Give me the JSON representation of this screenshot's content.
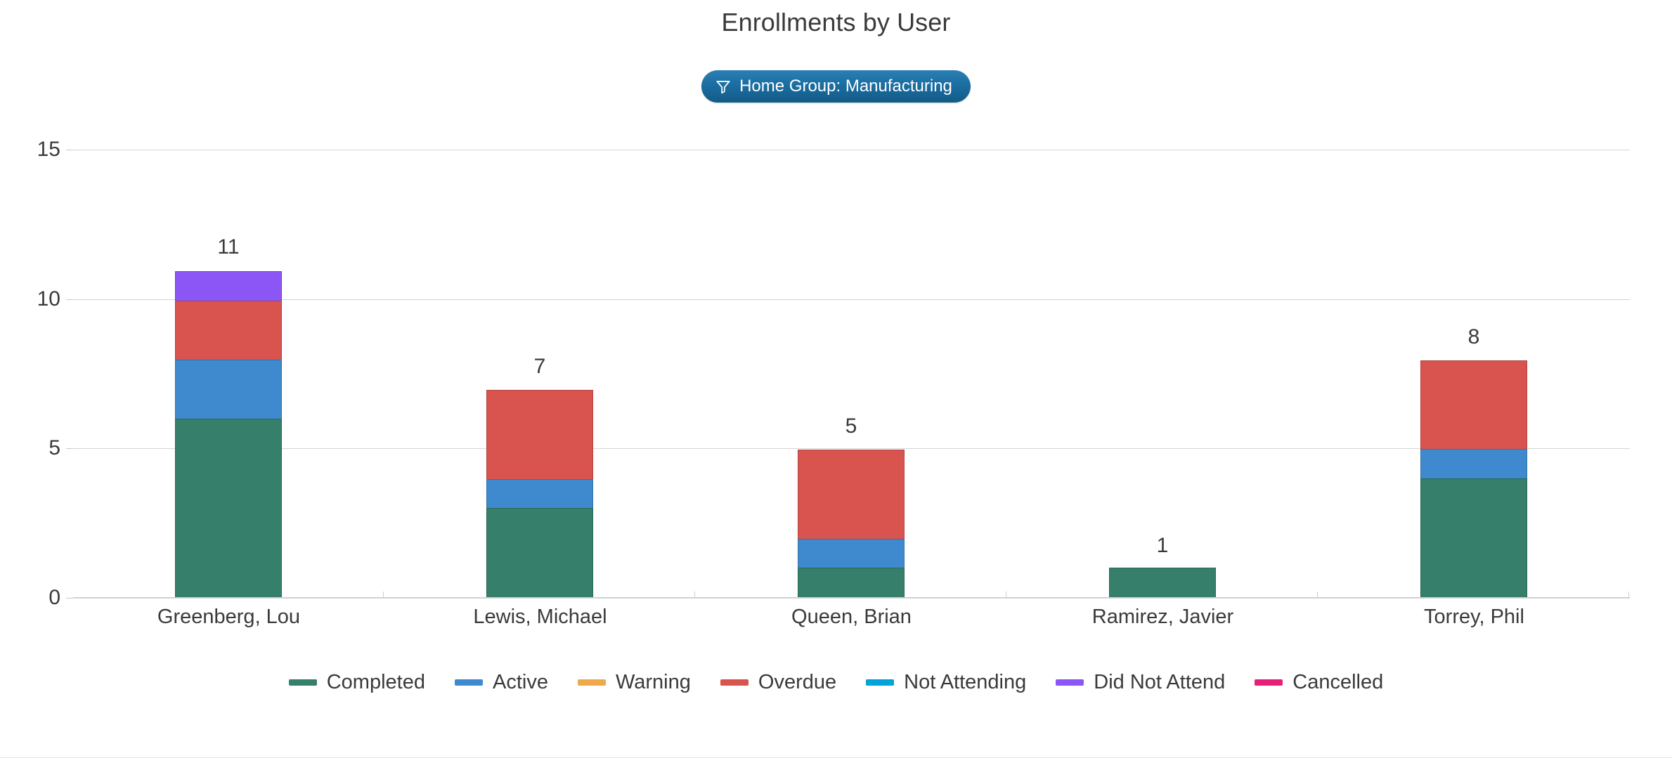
{
  "header": {
    "title": "Enrollments by User"
  },
  "filter": {
    "icon": "filter-funnel-icon",
    "label": "Home Group: Manufacturing",
    "chip_color": "#1b6e9f"
  },
  "chart_data": {
    "type": "bar",
    "stacked": true,
    "title": "Enrollments by User",
    "xlabel": "",
    "ylabel": "",
    "ylim": [
      0,
      15
    ],
    "yticks": [
      0,
      5,
      10,
      15
    ],
    "ytick_labels": [
      "0",
      "5",
      "10",
      "15"
    ],
    "grid": true,
    "legend_position": "bottom",
    "categories": [
      "Greenberg, Lou",
      "Lewis, Michael",
      "Queen, Brian",
      "Ramirez, Javier",
      "Torrey, Phil"
    ],
    "totals": [
      11,
      7,
      5,
      1,
      8
    ],
    "total_labels": [
      "11",
      "7",
      "5",
      "1",
      "8"
    ],
    "series": [
      {
        "name": "Completed",
        "color": "#357f6b",
        "values": [
          6,
          3,
          1,
          1,
          4
        ]
      },
      {
        "name": "Active",
        "color": "#3f8ace",
        "values": [
          2,
          1,
          1,
          0,
          1
        ]
      },
      {
        "name": "Warning",
        "color": "#efa94a",
        "values": [
          0,
          0,
          0,
          0,
          0
        ]
      },
      {
        "name": "Overdue",
        "color": "#d9534f",
        "values": [
          2,
          3,
          3,
          0,
          3
        ]
      },
      {
        "name": "Not Attending",
        "color": "#00a3d9",
        "values": [
          0,
          0,
          0,
          0,
          0
        ]
      },
      {
        "name": "Did Not Attend",
        "color": "#8c55f5",
        "values": [
          1,
          0,
          0,
          0,
          0
        ]
      },
      {
        "name": "Cancelled",
        "color": "#e91e78",
        "values": [
          0,
          0,
          0,
          0,
          0
        ]
      }
    ]
  }
}
